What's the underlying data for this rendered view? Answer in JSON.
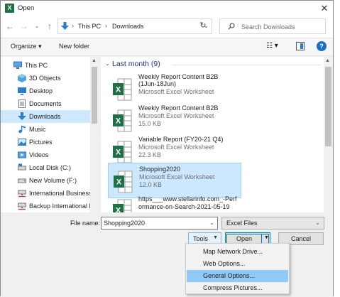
{
  "window": {
    "title": "Open",
    "app_icon": "X"
  },
  "address": {
    "crumbs": [
      "This PC",
      "Downloads"
    ]
  },
  "search": {
    "placeholder": "Search Downloads"
  },
  "toolbar": {
    "organize": "Organize ▾",
    "new_folder": "New folder",
    "help": "?"
  },
  "nav": {
    "items": [
      {
        "label": "This PC",
        "icon": "computer-icon"
      },
      {
        "label": "3D Objects",
        "icon": "cube-folder-icon"
      },
      {
        "label": "Desktop",
        "icon": "desktop-folder-icon"
      },
      {
        "label": "Documents",
        "icon": "documents-folder-icon"
      },
      {
        "label": "Downloads",
        "icon": "downloads-folder-icon",
        "selected": true
      },
      {
        "label": "Music",
        "icon": "music-folder-icon"
      },
      {
        "label": "Pictures",
        "icon": "pictures-folder-icon"
      },
      {
        "label": "Videos",
        "icon": "videos-folder-icon"
      },
      {
        "label": "Local Disk (C:)",
        "icon": "local-disk-icon"
      },
      {
        "label": "New Volume (F:)",
        "icon": "drive-icon"
      },
      {
        "label": "International Business",
        "icon": "network-drive-icon"
      },
      {
        "label": "Backup International Business",
        "icon": "network-drive-icon"
      }
    ]
  },
  "files": {
    "group": "Last month (9)",
    "items": [
      {
        "name_line1": "Weekly Report Content B2B",
        "name_line2": "(1Jun-18Jun)",
        "type": "Microsoft Excel Worksheet",
        "size": ""
      },
      {
        "name_line1": "Weekly Report Content B2B",
        "name_line2": "",
        "type": "Microsoft Excel Worksheet",
        "size": "15.0 KB"
      },
      {
        "name_line1": "Variable Report (FY20-21 Q4)",
        "name_line2": "",
        "type": "Microsoft Excel Worksheet",
        "size": "22.3 KB"
      },
      {
        "name_line1": "Shopping2020",
        "name_line2": "",
        "type": "Microsoft Excel Worksheet",
        "size": "12.0 KB",
        "selected": true
      },
      {
        "name_line1": "https___www.stellarinfo.com_-Perf",
        "name_line2": "ormance-on-Search-2021-05-19",
        "type": "",
        "size": ""
      }
    ]
  },
  "bottom": {
    "file_name_label": "File name:",
    "file_name_value": "Shopping2020",
    "file_type": "Excel Files",
    "tools_label": "Tools",
    "open_label": "Open",
    "cancel_label": "Cancel"
  },
  "tools_menu": {
    "items": [
      "Map Network Drive...",
      "Web Options...",
      "General Options...",
      "Compress Pictures..."
    ],
    "highlighted_index": 2
  },
  "colors": {
    "accent": "#0078d7",
    "selection": "#cce8ff",
    "excel_green": "#1e7145",
    "menu_highlight": "#91c9f7"
  }
}
